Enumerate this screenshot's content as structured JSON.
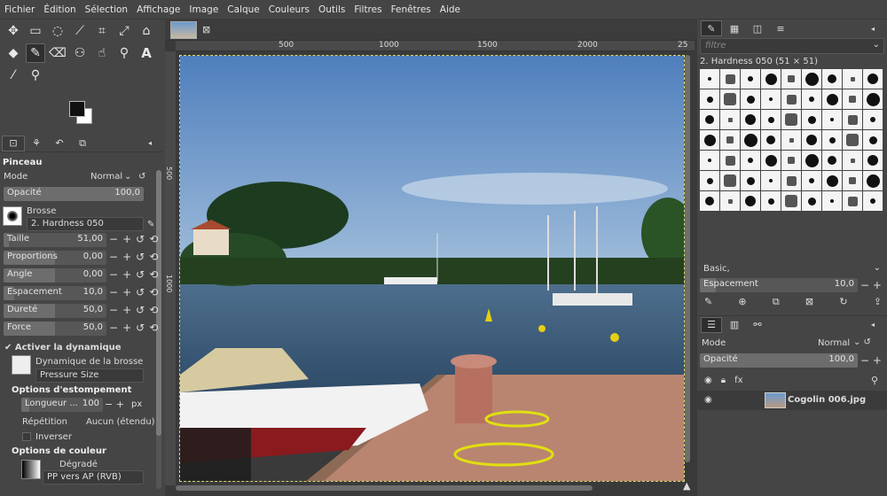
{
  "menu": [
    "Fichier",
    "Édition",
    "Sélection",
    "Affichage",
    "Image",
    "Calque",
    "Couleurs",
    "Outils",
    "Filtres",
    "Fenêtres",
    "Aide"
  ],
  "tool_options": {
    "title": "Pinceau",
    "mode_label": "Mode",
    "mode_value": "Normal",
    "opacity_label": "Opacité",
    "opacity_value": "100,0",
    "opacity_fill": 1.0,
    "brush_label": "Brosse",
    "brush_value": "2. Hardness 050",
    "sliders": [
      {
        "label": "Taille",
        "value": "51,00",
        "fill": 0.05
      },
      {
        "label": "Proportions",
        "value": "0,00",
        "fill": 0.5
      },
      {
        "label": "Angle",
        "value": "0,00",
        "fill": 0.5
      },
      {
        "label": "Espacement",
        "value": "10,0",
        "fill": 0.1
      },
      {
        "label": "Dureté",
        "value": "50,0",
        "fill": 0.5
      },
      {
        "label": "Force",
        "value": "50,0",
        "fill": 0.5
      }
    ],
    "dynamics_check": "Activer la dynamique",
    "dynamics_label": "Dynamique de la brosse",
    "dynamics_value": "Pressure Size",
    "fade_header": "Options d'estompement",
    "fade_length_label": "Longueur ...",
    "fade_length_value": "100",
    "fade_unit": "px",
    "repeat_label": "Répétition",
    "repeat_value": "Aucun (étendu)",
    "invert_label": "Inverser",
    "color_header": "Options de couleur",
    "gradient_label": "Dégradé",
    "gradient_value": "PP vers AP (RVB)"
  },
  "ruler_ticks": [
    "500",
    "1000",
    "1500",
    "2000",
    "25"
  ],
  "ruler_v_ticks": [
    "500",
    "1000"
  ],
  "brushes": {
    "filter_placeholder": "filtre",
    "current": "2. Hardness 050 (51 × 51)",
    "preset": "Basic,",
    "spacing_label": "Espacement",
    "spacing_value": "10,0"
  },
  "layers": {
    "mode_label": "Mode",
    "mode_value": "Normal",
    "opacity_label": "Opacité",
    "opacity_value": "100,0",
    "layer_name": "Cogolin 006.jpg"
  }
}
